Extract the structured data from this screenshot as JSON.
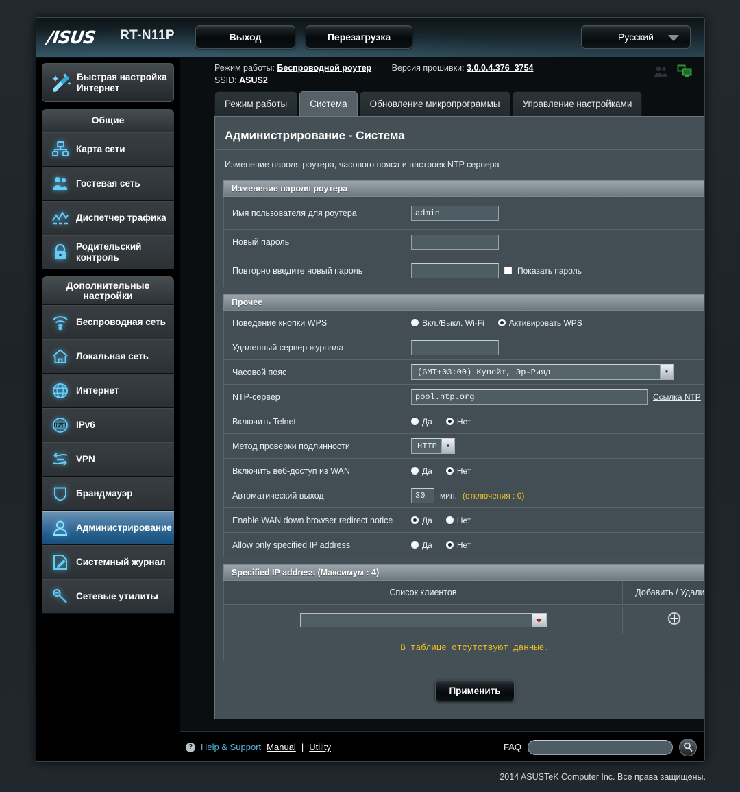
{
  "topbar": {
    "brand": "/ISUS",
    "model": "RT-N11P",
    "logout_label": "Выход",
    "reboot_label": "Перезагрузка",
    "language": "Русский"
  },
  "info": {
    "opmode_label": "Режим работы:",
    "opmode_value": "Беспроводной  роутер",
    "firmware_label": "Версия прошивки:",
    "firmware_value": "3.0.0.4.376_3754",
    "ssid_label": "SSID:",
    "ssid_value": "ASUS2"
  },
  "tabs": [
    {
      "label": "Режим работы",
      "active": false
    },
    {
      "label": "Система",
      "active": true
    },
    {
      "label": "Обновление микропрограммы",
      "active": false
    },
    {
      "label": "Управление настройками",
      "active": false
    }
  ],
  "sidebar": {
    "quick_setup": "Быстрая настройка Интернет",
    "groups": [
      {
        "title": "Общие",
        "items": [
          {
            "label": "Карта сети",
            "icon": "network-map-icon",
            "active": false
          },
          {
            "label": "Гостевая сеть",
            "icon": "guest-network-icon",
            "active": false
          },
          {
            "label": "Диспетчер трафика",
            "icon": "traffic-manager-icon",
            "active": false
          },
          {
            "label": "Родительский контроль",
            "icon": "parental-control-icon",
            "active": false
          }
        ]
      },
      {
        "title": "Дополнительные настройки",
        "items": [
          {
            "label": "Беспроводная сеть",
            "icon": "wifi-icon",
            "active": false
          },
          {
            "label": "Локальная сеть",
            "icon": "home-icon",
            "active": false
          },
          {
            "label": "Интернет",
            "icon": "globe-icon",
            "active": false
          },
          {
            "label": "IPv6",
            "icon": "ipv6-icon",
            "active": false
          },
          {
            "label": "VPN",
            "icon": "vpn-icon",
            "active": false
          },
          {
            "label": "Брандмауэр",
            "icon": "shield-icon",
            "active": false
          },
          {
            "label": "Администрирование",
            "icon": "admin-user-icon",
            "active": true
          },
          {
            "label": "Системный журнал",
            "icon": "syslog-icon",
            "active": false
          },
          {
            "label": "Сетевые утилиты",
            "icon": "network-tools-icon",
            "active": false
          }
        ]
      }
    ]
  },
  "page": {
    "title": "Администрирование - Система",
    "subtitle": "Изменение пароля роутера, часового пояса и настроек NTP сервера"
  },
  "password_section": {
    "header": "Изменение пароля роутера",
    "username_label": "Имя пользователя для роутера",
    "username_value": "admin",
    "new_password_label": "Новый пароль",
    "new_password_value": "",
    "retype_password_label": "Повторно введите новый пароль",
    "retype_password_value": "",
    "show_password_label": "Показать пароль"
  },
  "misc_section": {
    "header": "Прочее",
    "wps_label": "Поведение кнопки WPS",
    "wps_option1": "Вкл./Выкл. Wi-Fi",
    "wps_option2": "Активировать WPS",
    "wps_selected": 2,
    "logserver_label": "Удаленный сервер журнала",
    "logserver_value": "",
    "timezone_label": "Часовой пояс",
    "timezone_value": "(GMT+03:00)  Кувейт,  Эр-Рияд",
    "ntp_label": "NTP-сервер",
    "ntp_value": "pool.ntp.org",
    "ntp_link": "Ссылка NTP",
    "telnet_label": "Включить Telnet",
    "telnet_yes": "Да",
    "telnet_no": "Нет",
    "telnet_selected": "no",
    "auth_label": "Метод проверки подлинности",
    "auth_value": "HTTP",
    "wanweb_label": "Включить веб-доступ из WAN",
    "wanweb_yes": "Да",
    "wanweb_no": "Нет",
    "wanweb_selected": "no",
    "autologout_label": "Автоматический выход",
    "autologout_value": "30",
    "autologout_unit": "мин.",
    "autologout_note": "(отключения : 0)",
    "wandown_label": "Enable WAN down browser redirect notice",
    "wandown_yes": "Да",
    "wandown_no": "Нет",
    "wandown_selected": "yes",
    "allowip_label": "Allow only specified IP address",
    "allowip_yes": "Да",
    "allowip_no": "Нет",
    "allowip_selected": "no"
  },
  "ip_section": {
    "header": "Specified IP address (Максимум : 4)",
    "col_clients": "Список клиентов",
    "col_actions": "Добавить / Удалить",
    "client_select_value": "",
    "empty_message": "В таблице отсутствуют данные."
  },
  "apply_label": "Применить",
  "footer": {
    "help_support": "Help & Support",
    "manual": "Manual",
    "separator": "|",
    "utility": "Utility",
    "faq_label": "FAQ",
    "faq_value": "",
    "copyright": "2014  ASUSTeK Computer Inc. Все права защищены."
  }
}
